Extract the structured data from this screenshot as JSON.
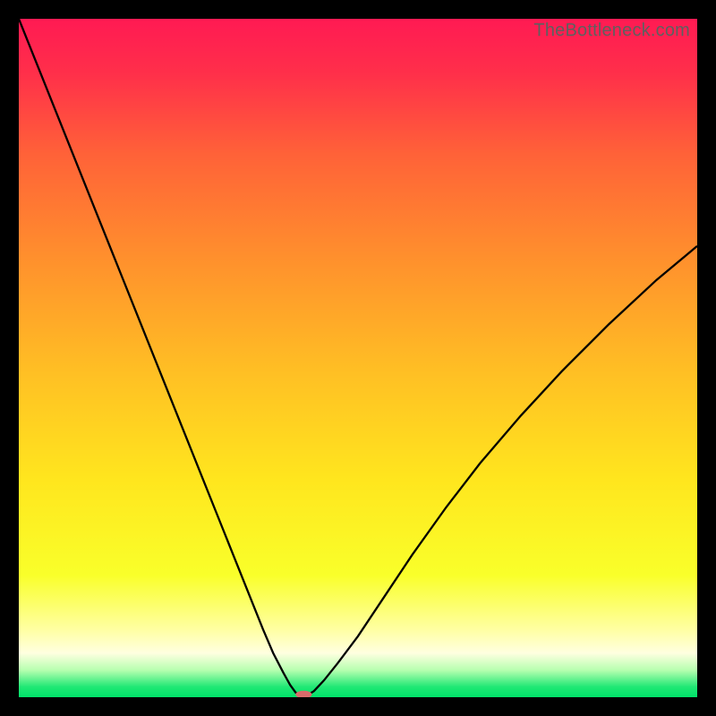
{
  "watermark": "TheBottleneck.com",
  "chart_data": {
    "type": "line",
    "title": "",
    "xlabel": "",
    "ylabel": "",
    "xlim": [
      0,
      100
    ],
    "ylim": [
      0,
      100
    ],
    "grid": false,
    "background_gradient_stops": [
      {
        "offset": 0.0,
        "color": "#ff1a53"
      },
      {
        "offset": 0.08,
        "color": "#ff2f4a"
      },
      {
        "offset": 0.2,
        "color": "#ff6238"
      },
      {
        "offset": 0.35,
        "color": "#ff8f2d"
      },
      {
        "offset": 0.52,
        "color": "#ffbf24"
      },
      {
        "offset": 0.68,
        "color": "#ffe61e"
      },
      {
        "offset": 0.82,
        "color": "#f9ff2a"
      },
      {
        "offset": 0.9,
        "color": "#ffffa2"
      },
      {
        "offset": 0.935,
        "color": "#ffffe0"
      },
      {
        "offset": 0.96,
        "color": "#b7ffb0"
      },
      {
        "offset": 0.985,
        "color": "#1fe874"
      },
      {
        "offset": 1.0,
        "color": "#00e36a"
      }
    ],
    "series": [
      {
        "name": "bottleneck-curve",
        "color": "#000000",
        "stroke_width": 2.3,
        "x": [
          0,
          3,
          6,
          9,
          12,
          15,
          18,
          21,
          24,
          27,
          30,
          32,
          34,
          36,
          37.5,
          39,
          40,
          40.8,
          41.4,
          41.8,
          42.2,
          43.5,
          45,
          47,
          50,
          54,
          58,
          63,
          68,
          74,
          80,
          87,
          94,
          100
        ],
        "y": [
          100,
          92.5,
          85,
          77.5,
          70,
          62.5,
          55,
          47.5,
          40,
          32.5,
          25,
          20,
          15,
          10,
          6.5,
          3.6,
          1.8,
          0.7,
          0.2,
          0,
          0.1,
          0.9,
          2.5,
          5,
          9,
          15,
          21,
          28,
          34.5,
          41.5,
          48,
          55,
          61.5,
          66.5
        ]
      }
    ],
    "marker": {
      "name": "result-marker",
      "x": 42,
      "y": 0.4,
      "rx_pct": 1.2,
      "ry_pct": 0.55,
      "color": "#d96b6b"
    }
  }
}
